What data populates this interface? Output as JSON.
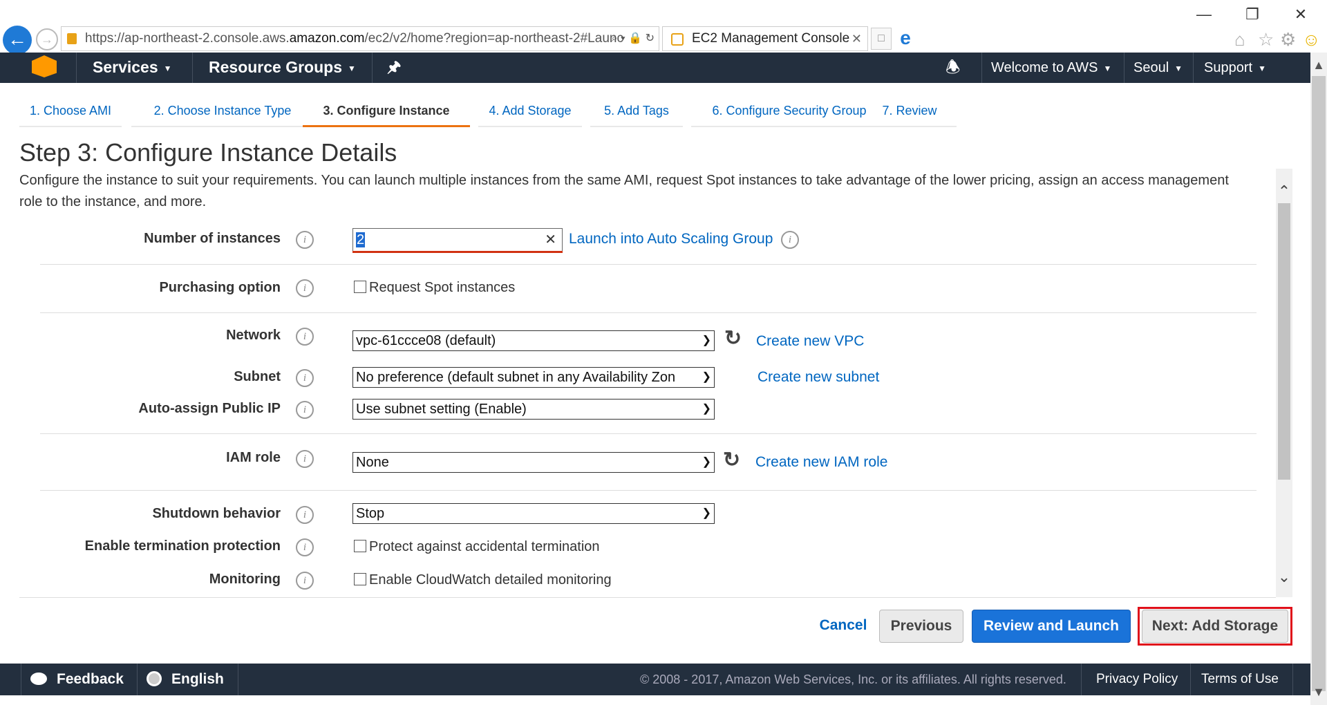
{
  "browser": {
    "url_prefix": "https://ap-northeast-2.console.aws.",
    "url_domain": "amazon.com",
    "url_suffix": "/ec2/v2/home?region=ap-northeast-2#Launc",
    "tab_title": "EC2 Management Console"
  },
  "topnav": {
    "services": "Services",
    "resource_groups": "Resource Groups",
    "welcome": "Welcome to AWS",
    "region": "Seoul",
    "support": "Support"
  },
  "steps": [
    "1. Choose AMI",
    "2. Choose Instance Type",
    "3. Configure Instance",
    "4. Add Storage",
    "5. Add Tags",
    "6. Configure Security Group",
    "7. Review"
  ],
  "page": {
    "title": "Step 3: Configure Instance Details",
    "description": "Configure the instance to suit your requirements. You can launch multiple instances from the same AMI, request Spot instances to take advantage of the lower pricing, assign an access management role to the instance, and more."
  },
  "form": {
    "num_instances_label": "Number of instances",
    "num_instances_value": "2",
    "auto_scaling_link": "Launch into Auto Scaling Group",
    "purchasing_label": "Purchasing option",
    "spot_checkbox": "Request Spot instances",
    "network_label": "Network",
    "network_value": "vpc-61ccce08 (default)",
    "create_vpc": "Create new VPC",
    "subnet_label": "Subnet",
    "subnet_value": "No preference (default subnet in any Availability Zon",
    "create_subnet": "Create new subnet",
    "public_ip_label": "Auto-assign Public IP",
    "public_ip_value": "Use subnet setting (Enable)",
    "iam_label": "IAM role",
    "iam_value": "None",
    "create_iam": "Create new IAM role",
    "shutdown_label": "Shutdown behavior",
    "shutdown_value": "Stop",
    "termination_label": "Enable termination protection",
    "termination_checkbox": "Protect against accidental termination",
    "monitoring_label": "Monitoring",
    "monitoring_checkbox": "Enable CloudWatch detailed monitoring"
  },
  "actions": {
    "cancel": "Cancel",
    "previous": "Previous",
    "review_launch": "Review and Launch",
    "next": "Next: Add Storage"
  },
  "footer": {
    "feedback": "Feedback",
    "language": "English",
    "copyright": "© 2008 - 2017, Amazon Web Services, Inc. or its affiliates. All rights reserved.",
    "privacy": "Privacy Policy",
    "terms": "Terms of Use"
  },
  "colors": {
    "aws_nav": "#232f3e",
    "accent_orange": "#ec7211",
    "link_blue": "#0066c0",
    "primary_button": "#1a73d9",
    "highlight_red": "#e0101a"
  }
}
